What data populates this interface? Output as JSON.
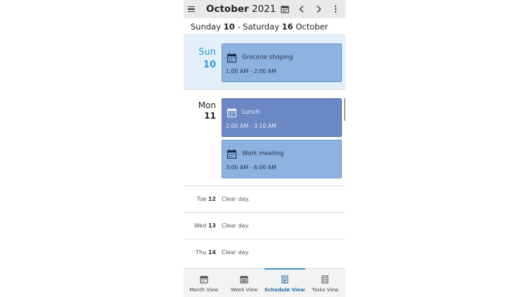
{
  "header": {
    "month": "October",
    "year": "2021"
  },
  "range": {
    "start_weekday": "Sunday",
    "start_day": "10",
    "separator": " - ",
    "end_weekday": "Saturday",
    "end_day": "16",
    "end_month": "October"
  },
  "days": [
    {
      "name": "Sun",
      "num": "10",
      "appointments": [
        {
          "title": "Grocerie shoping",
          "time": "1:00 AM - 2:00 AM"
        }
      ]
    },
    {
      "name": "Mon",
      "num": "11",
      "appointments": [
        {
          "title": "Lunch",
          "time": "2:00 AM - 3:10 AM"
        },
        {
          "title": "Work meeting",
          "time": "3:00 AM - 6:00 AM"
        }
      ]
    }
  ],
  "clear_days": [
    {
      "name": "Tue",
      "num": "12",
      "text": "Clear day."
    },
    {
      "name": "Wed",
      "num": "13",
      "text": "Clear day."
    },
    {
      "name": "Thu",
      "num": "14",
      "text": "Clear day."
    }
  ],
  "nav": {
    "month": "Month View",
    "week": "Week View",
    "schedule": "Schedule View",
    "tasks": "Tasks View",
    "active": "Schedule View"
  },
  "icons": {
    "menu": "hamburger-icon",
    "calendar": "calendar-icon",
    "prev": "chevron-left-icon",
    "next": "chevron-right-icon",
    "more": "more-vertical-icon"
  },
  "colors": {
    "appointment": "#8db2e0",
    "appointment_selected": "#6b88c4",
    "today_bg": "#e3f0fa",
    "accent": "#2e9ad8"
  }
}
